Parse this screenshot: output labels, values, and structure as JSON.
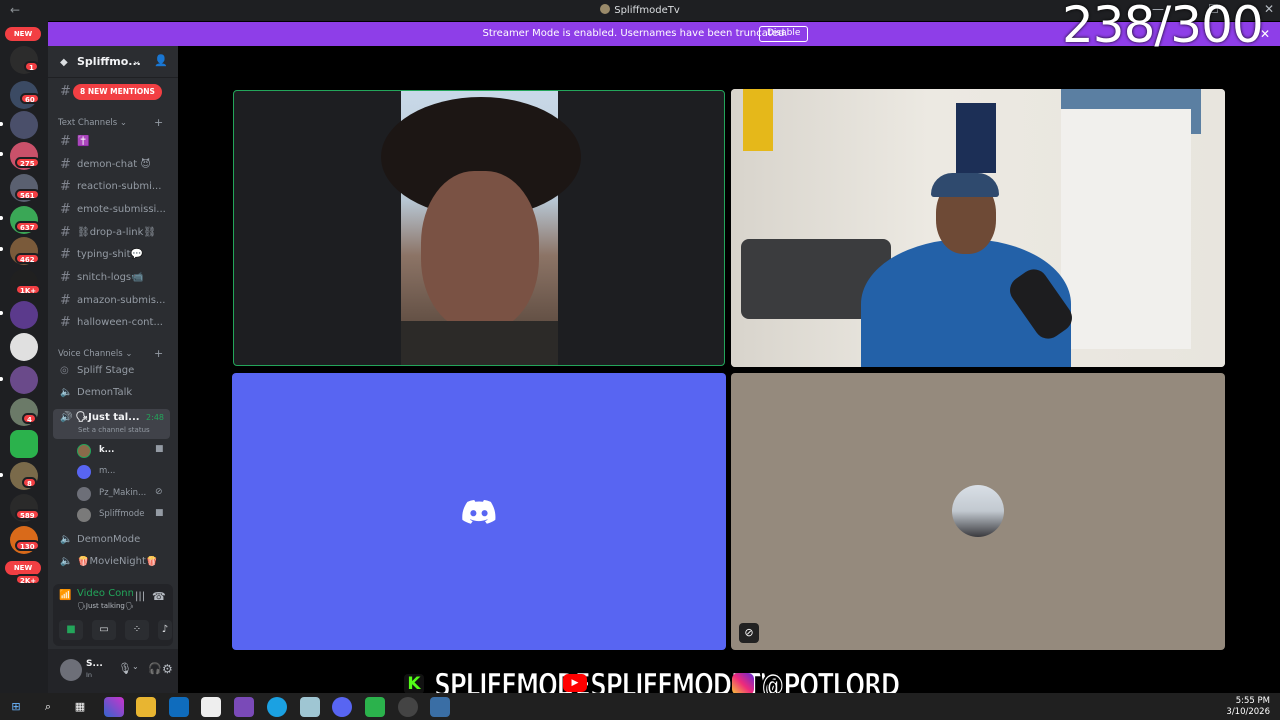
{
  "window": {
    "title": "SpliffmodeTv"
  },
  "banner": {
    "message": "Streamer Mode is enabled. Usernames have been truncated.",
    "disable_label": "Disable"
  },
  "counter": "238/300",
  "rail": {
    "new_top": "NEW",
    "new_bottom": "NEW",
    "badges": [
      "1",
      "60",
      "275",
      "561",
      "637",
      "462",
      "1K+",
      "4",
      "8",
      "589",
      "130",
      "2K+"
    ]
  },
  "guild": {
    "name": "Spliffmo...",
    "new_mentions": "8 NEW MENTIONS"
  },
  "categories": {
    "text": "Text Channels",
    "voice": "Voice Channels"
  },
  "text_channels": [
    "✝️",
    "demon-chat 😈",
    "reaction-submi...",
    "emote-submissi...",
    "⛓drop-a-link⛓",
    "typing-shit💬",
    "snitch-logs📹",
    "amazon-submis...",
    "halloween-cont..."
  ],
  "voice_channels": [
    "Spliff Stage",
    "DemonTalk"
  ],
  "active_voice": {
    "name": "🗣Just tal...",
    "time": "2:48",
    "status": "Set a channel status"
  },
  "members": [
    "k...",
    "m...",
    "Pz_Makin...",
    "Spliffmode"
  ],
  "more_voice": [
    "DemonMode",
    "🍿MovieNight🍿"
  ],
  "voice_connected": {
    "title": "Video Connected",
    "subtitle": "🗣Just talking🗣 / ..."
  },
  "user": {
    "name": "S...",
    "status": "In"
  },
  "socials": [
    {
      "platform": "kick",
      "handle": "SPLIFFMODE"
    },
    {
      "platform": "youtube",
      "handle": "SPLIFFMODETV"
    },
    {
      "platform": "instagram",
      "handle": "@POTLORD"
    }
  ],
  "clock": {
    "time": "5:55 PM",
    "date": "3/10/2026"
  },
  "colors": {
    "discord_blurple": "#5865f2",
    "streamer_purple": "#8e3ee8",
    "online_green": "#23a55a",
    "alert_red": "#f23f43"
  }
}
